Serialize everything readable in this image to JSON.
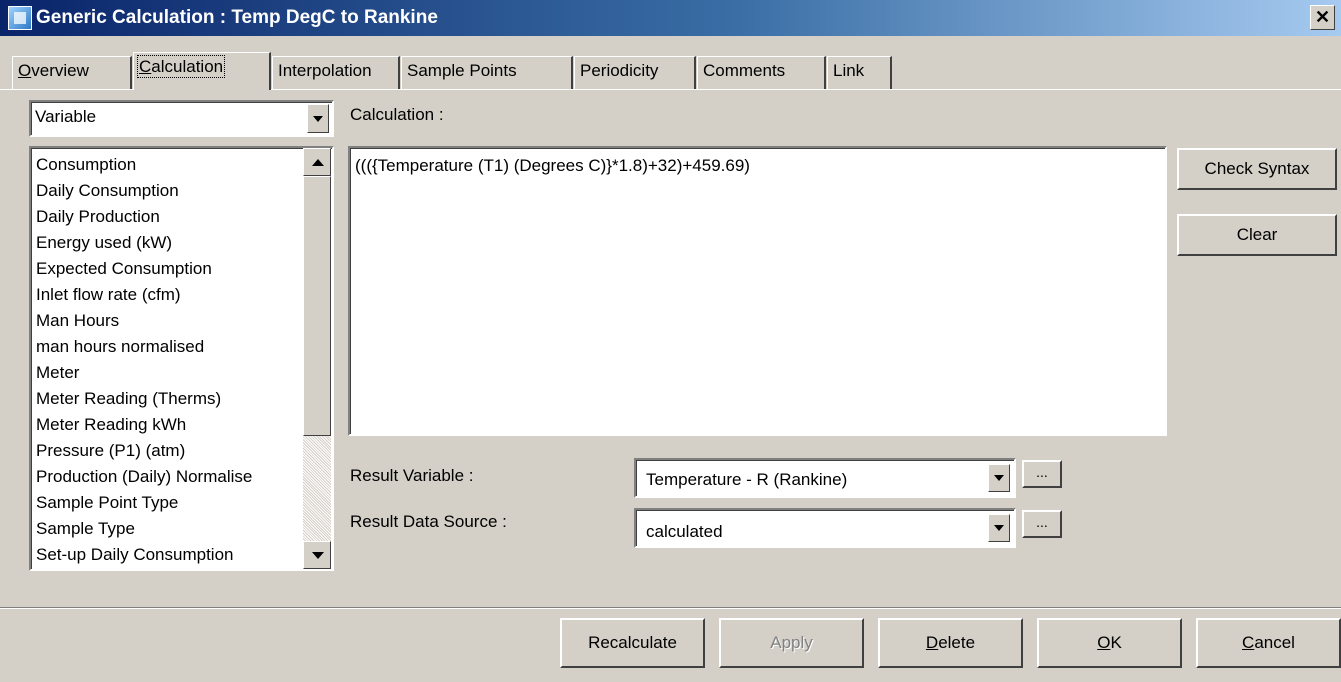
{
  "window": {
    "title": "Generic Calculation : Temp DegC to Rankine",
    "close_label": "✕"
  },
  "tabs": [
    {
      "label_u": "O",
      "label_rest": "verview"
    },
    {
      "label_u": "C",
      "label_rest": "alculation"
    },
    {
      "label": "Interpolation"
    },
    {
      "label": "Sample Points"
    },
    {
      "label": "Periodicity"
    },
    {
      "label": "Comments"
    },
    {
      "label": "Link"
    }
  ],
  "type_select": {
    "value": "Variable"
  },
  "variables": [
    "Consumption",
    "Daily Consumption",
    "Daily Production",
    "Energy used (kW)",
    "Expected Consumption",
    "Inlet flow rate (cfm)",
    "Man Hours",
    "man hours normalised",
    "Meter",
    "Meter Reading (Therms)",
    "Meter Reading kWh",
    "Pressure (P1) (atm)",
    "Production (Daily) Normalise",
    "Sample Point Type",
    "Sample Type",
    "Set-up Daily Consumption"
  ],
  "calculation": {
    "label": "Calculation :",
    "expression": "((({Temperature (T1) (Degrees C)}*1.8)+32)+459.69)"
  },
  "side_buttons": {
    "check_syntax": "Check Syntax",
    "clear": "Clear"
  },
  "result_variable": {
    "label": "Result Variable :",
    "value": "Temperature - R (Rankine)",
    "browse": "..."
  },
  "result_data_source": {
    "label": "Result Data Source :",
    "value": "calculated",
    "browse": "..."
  },
  "footer_buttons": {
    "recalculate": "Recalculate",
    "apply": "Apply",
    "delete_u": "D",
    "delete_rest": "elete",
    "ok_u": "O",
    "ok_rest": "K",
    "cancel_u": "C",
    "cancel_rest": "ancel"
  }
}
